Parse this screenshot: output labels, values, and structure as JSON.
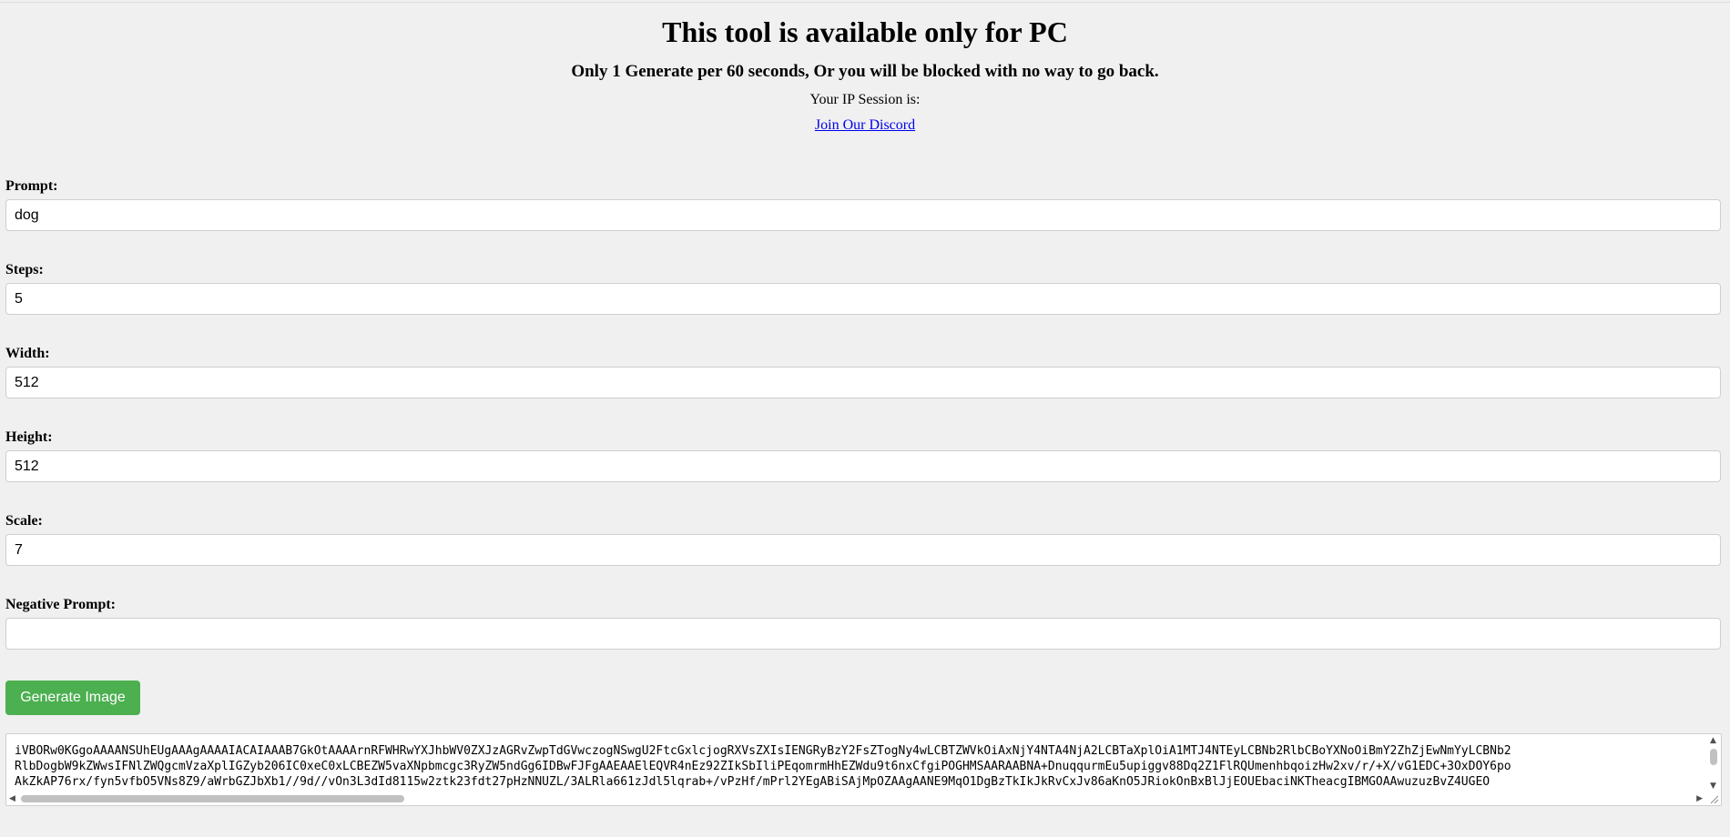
{
  "header": {
    "title": "This tool is available only for PC",
    "warning": "Only 1 Generate per 60 seconds, Or you will be blocked with no way to go back.",
    "ip_session": "Your IP Session is:",
    "discord_link": "Join Our Discord"
  },
  "form": {
    "prompt": {
      "label": "Prompt:",
      "value": "dog"
    },
    "steps": {
      "label": "Steps:",
      "value": "5"
    },
    "width": {
      "label": "Width:",
      "value": "512"
    },
    "height": {
      "label": "Height:",
      "value": "512"
    },
    "scale": {
      "label": "Scale:",
      "value": "7"
    },
    "negative_prompt": {
      "label": "Negative Prompt:",
      "value": ""
    },
    "generate_label": "Generate Image"
  },
  "output": {
    "line1": "iVBORw0KGgoAAAANSUhEUgAAAgAAAAIACAIAAAB7GkOtAAAArnRFWHRwYXJhbWV0ZXJzAGRvZwpTdGVwczogNSwgU2FtcGxlcjogRXVsZXIsIENGRyBzY2FsZTogNy4wLCBTZWVkOiAxNjY4NTA4NjA2LCBTaXplOiA1MTJ4NTEyLCBNb2RlbCBoYXNoOiBmY2ZhZjEwNmYyLCBNb2",
    "line2": "RlbDogbW9kZWwsIFNlZWQgcmVzaXplIGZyb206IC0xeC0xLCBEZW5vaXNpbmcgc3RyZW5ndGg6IDBwFJFgAAEAAElEQVR4nEz92ZIkSbIliPEqomrmHhEZWdu9t6nxCfgiPOGHMSAARAABNA+DnuqqurmEu5upiggv88Dq2Z1FlRQUmenhbqoizHw2xv/r/+X/vG1EDC+3OxDOY6po",
    "line3": "AkZkAP76rx/fyn5vfbO5VNs8Z9/aWrbGZJbXb1//9d//vOn3L3dId8115w2ztk23fdt27pHzNNUZL/3ALRla661zJdl5lqrab+/vPzHf/mPrl2YEgABiSAjMpOZAAgAANE9MqO1DgBzTkIkJkRvCxJv86aKnO5JRiokOnBxBlJjEOUEbaciNKTheacgIBMGOAAwuzuzBvZ4UGEO"
  }
}
